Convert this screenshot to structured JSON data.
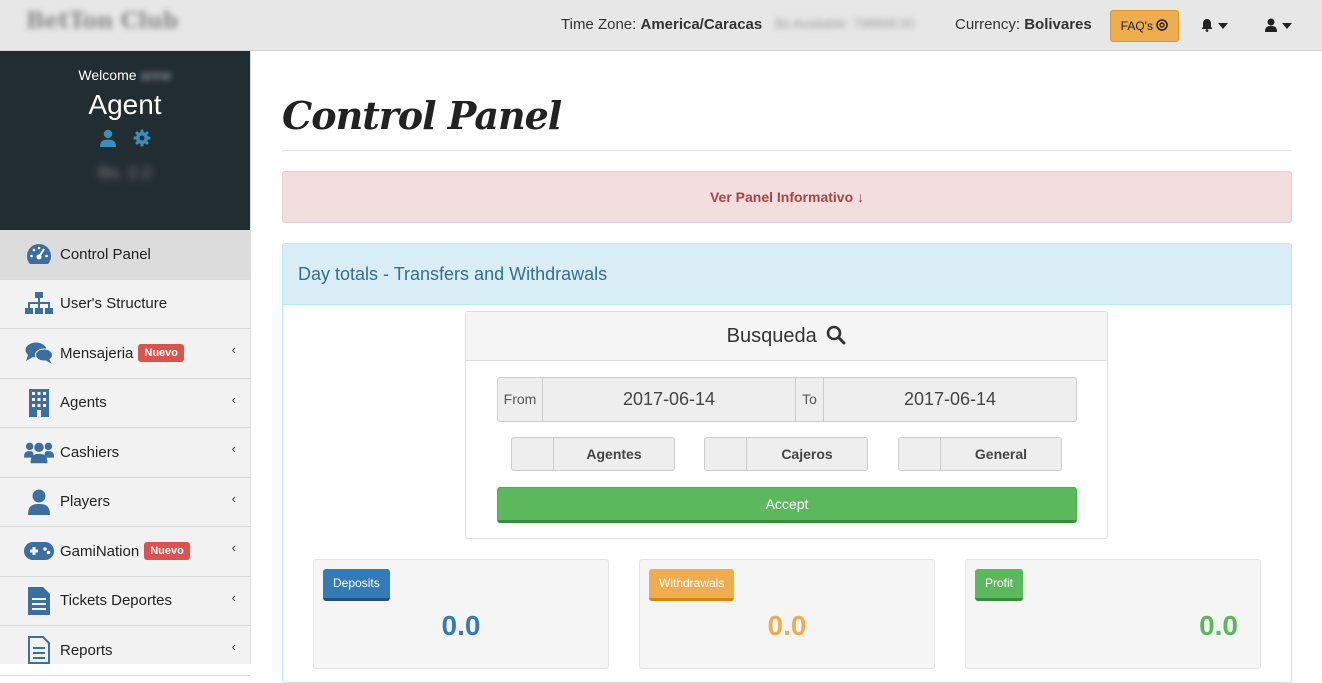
{
  "header": {
    "brand": "BetTon Club",
    "timezone_label": "Time Zone:",
    "timezone_value": "America/Caracas",
    "available": "Bs Available: 798899.00",
    "currency_label": "Currency:",
    "currency_value": "Bolivares",
    "faq_label": "FAQ's"
  },
  "profile": {
    "welcome": "Welcome",
    "username": "anne",
    "role": "Agent",
    "balance": "Bs. 2.2"
  },
  "sidebar": {
    "items": [
      {
        "label": "Control Panel",
        "icon": "dashboard-icon"
      },
      {
        "label": "User's Structure",
        "icon": "sitemap-icon"
      },
      {
        "label": "Mensajeria",
        "icon": "comments-icon",
        "badge": "Nuevo"
      },
      {
        "label": "Agents",
        "icon": "building-icon"
      },
      {
        "label": "Cashiers",
        "icon": "users-icon"
      },
      {
        "label": "Players",
        "icon": "user-icon"
      },
      {
        "label": "GamiNation",
        "icon": "gamepad-icon",
        "badge": "Nuevo"
      },
      {
        "label": "Tickets Deportes",
        "icon": "document-icon"
      },
      {
        "label": "Reports",
        "icon": "file-icon"
      }
    ]
  },
  "main": {
    "title": "Control Panel",
    "alert": "Ver Panel Informativo ↓",
    "panel_title": "Day totals - Transfers and Withdrawals",
    "search": {
      "title": "Busqueda",
      "from_label": "From",
      "from_value": "2017-06-14",
      "to_label": "To",
      "to_value": "2017-06-14",
      "options": [
        "Agentes",
        "Cajeros",
        "General"
      ],
      "accept": "Accept"
    },
    "stats": [
      {
        "label": "Deposits",
        "value": "0.0",
        "color": "#337ab7"
      },
      {
        "label": "Withdrawals",
        "value": "0.0",
        "color": "#f0ad4e"
      },
      {
        "label": "Profit",
        "value": "0.0",
        "color": "#5cb85c"
      }
    ]
  }
}
